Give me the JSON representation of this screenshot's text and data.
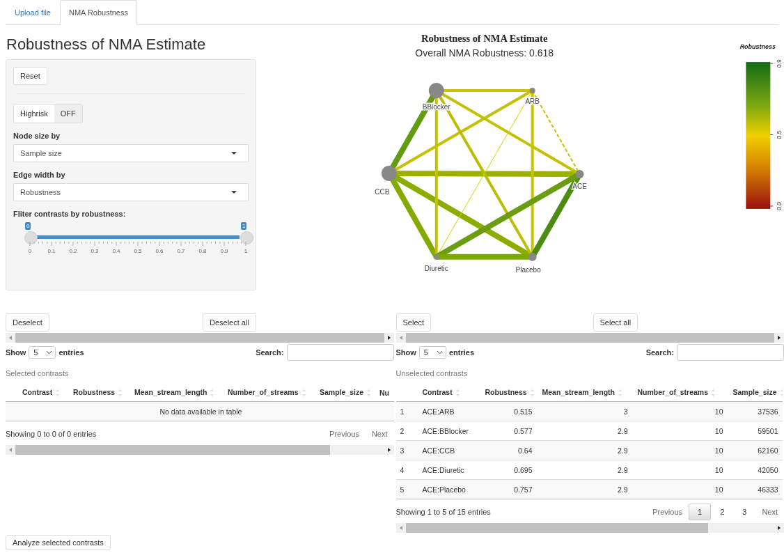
{
  "tabs": [
    {
      "label": "Upload file",
      "selected": false
    },
    {
      "label": "NMA Robustness",
      "selected": true
    }
  ],
  "page_title": "Robustness of NMA Estimate",
  "controls": {
    "reset": "Reset",
    "highrisk": {
      "label": "Highrisk",
      "state_label": "OFF",
      "on": false
    },
    "node_size": {
      "label": "Node size by",
      "value": "Sample size"
    },
    "edge_width": {
      "label": "Edge width by",
      "value": "Robustness"
    },
    "filter": {
      "label": "Fliter contrasts by robustness:",
      "low_label": "0",
      "high_label": "1",
      "level": 1,
      "ticks": [
        "0",
        "0.1",
        "0.2",
        "0.3",
        "0.4",
        "0.5",
        "0.6",
        "0.7",
        "0.8",
        "0.9",
        "1"
      ]
    }
  },
  "network": {
    "title": "Robustness of NMA Estimate",
    "subtitle": "Overall NMA Robustness: 0.618",
    "nodes": [
      {
        "label": "BBlocker",
        "kind": "large"
      },
      {
        "label": "ARB",
        "kind": "small"
      },
      {
        "label": "ACE",
        "kind": "medium"
      },
      {
        "label": "Placebo",
        "kind": "medium"
      },
      {
        "label": "Diuretic",
        "kind": "small"
      },
      {
        "label": "CCB",
        "kind": "large"
      }
    ],
    "legend": {
      "title": "Robustness",
      "ticks": [
        "0.9",
        "0.5",
        "0.0"
      ]
    }
  },
  "selected_panel": {
    "buttons": [
      "Deselect",
      "Deselect all"
    ],
    "show_label": "Show",
    "page_size": "5",
    "entries_label": "entries",
    "search_label": "Search:",
    "caption": "Selected contrasts",
    "columns": [
      "Contrast",
      "Robustness",
      "Mean_stream_length",
      "Number_of_streams",
      "Sample_size",
      "Nu"
    ],
    "empty_message": "No data available in table",
    "info": "Showing 0 to 0 of 0 entries",
    "pages": [
      {
        "label": "Previous",
        "kind": "nav",
        "selected": false
      },
      {
        "label": "Next",
        "kind": "nav",
        "selected": false
      }
    ]
  },
  "unselected_panel": {
    "buttons": [
      "Select",
      "Select all"
    ],
    "show_label": "Show",
    "page_size": "5",
    "entries_label": "entries",
    "search_label": "Search:",
    "caption": "Unselected contrasts",
    "columns": [
      "",
      "Contrast",
      "Robustness",
      "Mean_stream_length",
      "Number_of_streams",
      "Sample_size"
    ],
    "rows": [
      [
        "1",
        "ACE:ARB",
        "0.515",
        "3",
        "10",
        "37536"
      ],
      [
        "2",
        "ACE:BBlocker",
        "0.577",
        "2.9",
        "10",
        "59501"
      ],
      [
        "3",
        "ACE:CCB",
        "0.64",
        "2.9",
        "10",
        "62160"
      ],
      [
        "4",
        "ACE:Diuretic",
        "0.695",
        "2.9",
        "10",
        "42050"
      ],
      [
        "5",
        "ACE:Placebo",
        "0.757",
        "2.9",
        "10",
        "46333"
      ]
    ],
    "info": "Showing 1 to 5 of 15 entries",
    "pages": [
      {
        "label": "Previous",
        "kind": "nav",
        "selected": false
      },
      {
        "label": "1",
        "kind": "page",
        "selected": true
      },
      {
        "label": "2",
        "kind": "page",
        "selected": false
      },
      {
        "label": "3",
        "kind": "page",
        "selected": false
      },
      {
        "label": "Next",
        "kind": "nav",
        "selected": false
      }
    ]
  },
  "analyze_button": "Analyze selected contrasts"
}
